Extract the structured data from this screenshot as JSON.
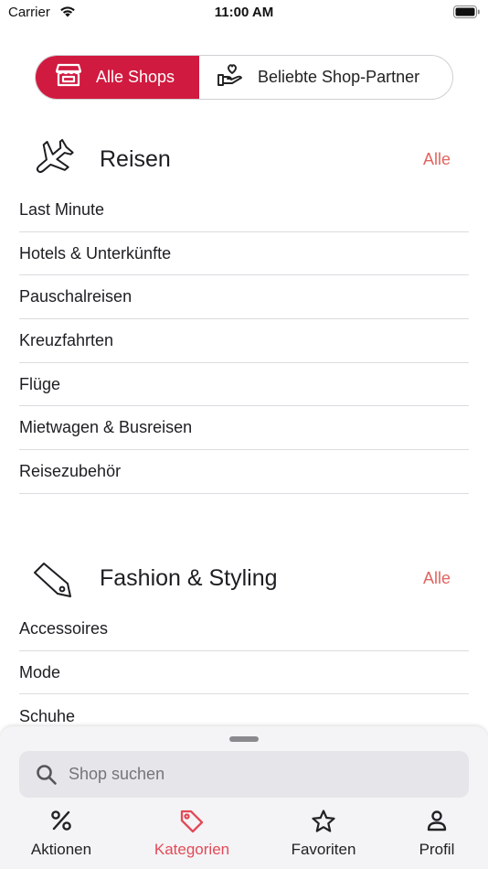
{
  "status_bar": {
    "carrier": "Carrier",
    "time": "11:00 AM"
  },
  "segment": {
    "active_label": "Alle Shops",
    "inactive_label": "Beliebte Shop-Partner",
    "active_icon": "storefront-icon",
    "inactive_icon": "hand-heart-icon"
  },
  "sections": [
    {
      "title": "Reisen",
      "all_label": "Alle",
      "icon": "airplane-icon",
      "items": [
        "Last Minute",
        "Hotels & Unterkünfte",
        "Pauschalreisen",
        "Kreuzfahrten",
        "Flüge",
        "Mietwagen & Busreisen",
        "Reisezubehör"
      ]
    },
    {
      "title": "Fashion & Styling",
      "all_label": "Alle",
      "icon": "tag-icon",
      "items": [
        "Accessoires",
        "Mode",
        "Schuhe"
      ]
    }
  ],
  "search": {
    "placeholder": "Shop suchen"
  },
  "tabs": [
    {
      "label": "Aktionen",
      "icon": "percent-icon",
      "active": false
    },
    {
      "label": "Kategorien",
      "icon": "tag-icon",
      "active": true
    },
    {
      "label": "Favoriten",
      "icon": "star-icon",
      "active": false
    },
    {
      "label": "Profil",
      "icon": "person-icon",
      "active": false
    }
  ],
  "colors": {
    "accent": "#d11a3f",
    "link": "#e06560",
    "active_tab": "#e34a57"
  }
}
